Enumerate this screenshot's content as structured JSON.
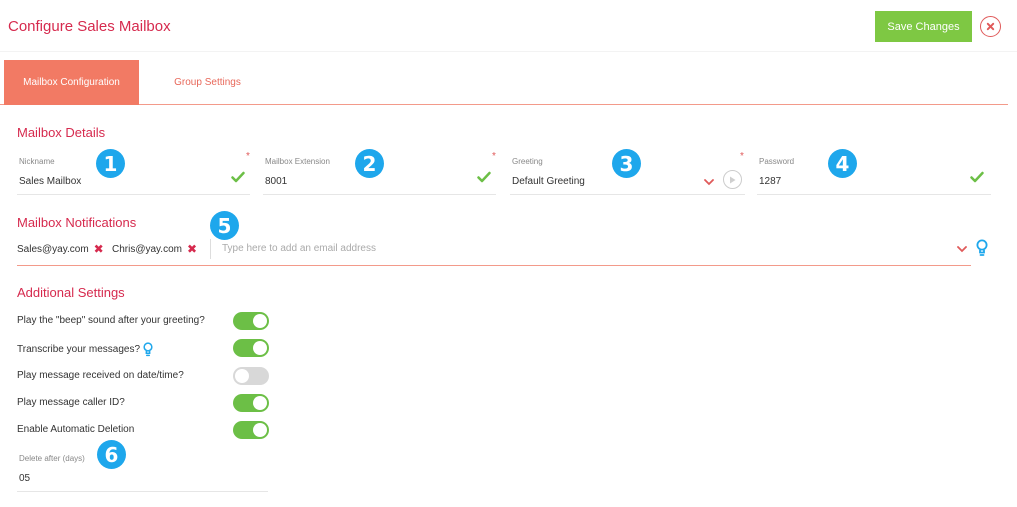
{
  "header": {
    "title": "Configure Sales Mailbox",
    "save_label": "Save Changes"
  },
  "tabs": [
    {
      "label": "Mailbox Configuration",
      "active": true
    },
    {
      "label": "Group Settings",
      "active": false
    }
  ],
  "mailbox_details": {
    "title": "Mailbox Details",
    "fields": [
      {
        "label": "Nickname",
        "value": "Sales Mailbox",
        "required": true,
        "valid": true,
        "badge": "1"
      },
      {
        "label": "Mailbox Extension",
        "value": "8001",
        "required": true,
        "valid": true,
        "badge": "2"
      },
      {
        "label": "Greeting",
        "value": "Default Greeting",
        "required": true,
        "badge": "3"
      },
      {
        "label": "Password",
        "value": "1287",
        "required": false,
        "valid": true,
        "badge": "4"
      }
    ]
  },
  "notifications": {
    "title": "Mailbox Notifications",
    "badge": "5",
    "emails": [
      "Sales@yay.com",
      "Chris@yay.com"
    ],
    "placeholder": "Type here to add an email address"
  },
  "additional_settings": {
    "title": "Additional Settings",
    "settings": [
      {
        "label": "Play the \"beep\" sound after your greeting?",
        "on": true
      },
      {
        "label": "Transcribe your messages?",
        "on": true,
        "hint_icon": "lightbulb-icon"
      },
      {
        "label": "Play message received on date/time?",
        "on": false
      },
      {
        "label": "Play message caller ID?",
        "on": true
      },
      {
        "label": "Enable Automatic Deletion",
        "on": true
      }
    ],
    "delete_after": {
      "label": "Delete after (days)",
      "value": "05",
      "badge": "6"
    }
  },
  "colors": {
    "accent": "#d62a4e",
    "tab_active": "#f27a64",
    "save_button": "#7ec843",
    "toggle_on": "#6cbf46",
    "toggle_off": "#d8d8d8",
    "badge": "#1ea7ec",
    "check": "#6cbf46",
    "hint": "#1ea7ec"
  }
}
